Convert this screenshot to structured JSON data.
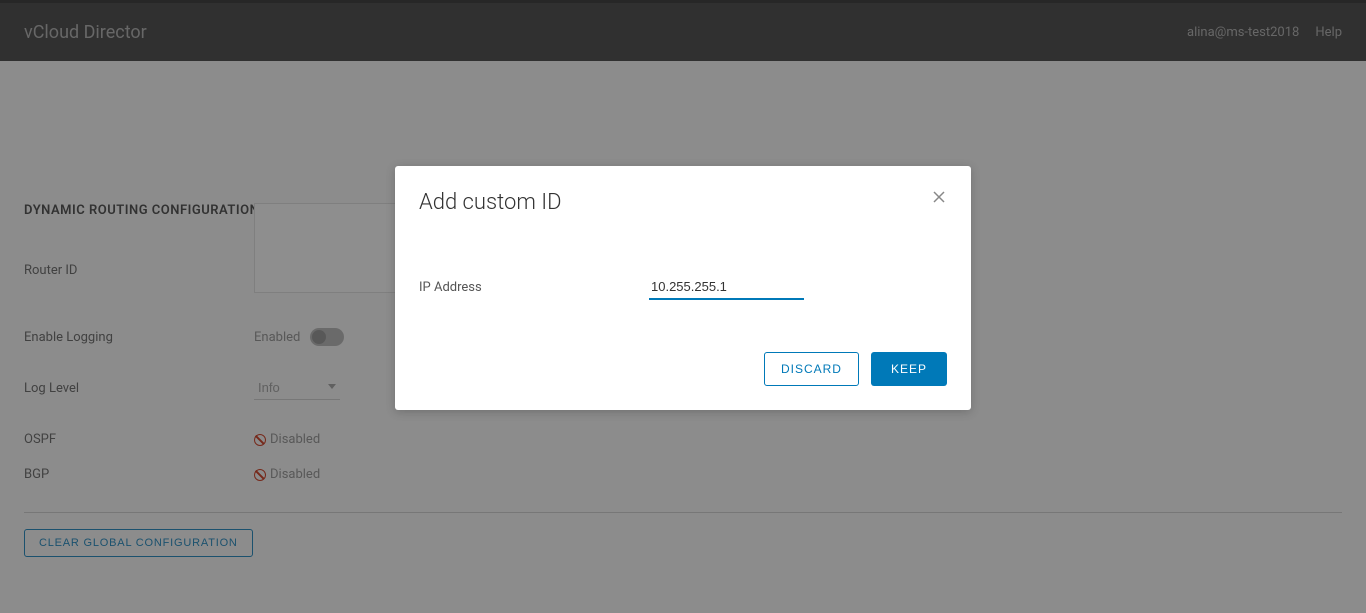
{
  "header": {
    "title": "vCloud Director",
    "user": "alina@ms-test2018",
    "help": "Help"
  },
  "section": {
    "title": "DYNAMIC ROUTING CONFIGURATION",
    "router_id_label": "Router ID",
    "enable_logging_label": "Enable Logging",
    "enabled_text": "Enabled",
    "log_level_label": "Log Level",
    "log_level_value": "Info",
    "ospf_label": "OSPF",
    "bgp_label": "BGP",
    "disabled_text": "Disabled",
    "clear_button": "CLEAR GLOBAL CONFIGURATION"
  },
  "modal": {
    "title": "Add custom ID",
    "ip_label": "IP Address",
    "ip_value": "10.255.255.1",
    "discard": "DISCARD",
    "keep": "KEEP"
  }
}
